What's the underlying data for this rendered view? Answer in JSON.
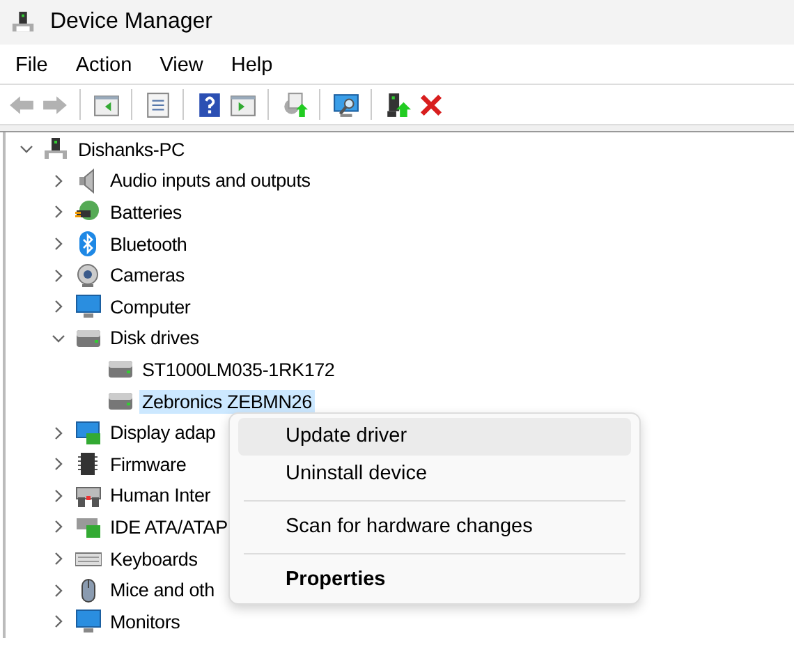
{
  "window": {
    "title": "Device Manager"
  },
  "menu_bar": [
    "File",
    "Action",
    "View",
    "Help"
  ],
  "toolbar": [
    {
      "kind": "back",
      "disabled": true
    },
    {
      "kind": "forward",
      "disabled": true
    },
    {
      "kind": "sep"
    },
    {
      "kind": "tree-pane"
    },
    {
      "kind": "sep"
    },
    {
      "kind": "sheet"
    },
    {
      "kind": "sep"
    },
    {
      "kind": "help"
    },
    {
      "kind": "action-pane"
    },
    {
      "kind": "sep"
    },
    {
      "kind": "update"
    },
    {
      "kind": "sep"
    },
    {
      "kind": "scan"
    },
    {
      "kind": "sep"
    },
    {
      "kind": "enable"
    },
    {
      "kind": "remove"
    }
  ],
  "tree": {
    "label": "Dishanks-PC",
    "kind": "pc",
    "expanded": true,
    "children": [
      {
        "label": "Audio inputs and outputs",
        "kind": "speaker",
        "expanded": false
      },
      {
        "label": "Batteries",
        "kind": "battery",
        "expanded": false
      },
      {
        "label": "Bluetooth",
        "kind": "bluetooth",
        "expanded": false
      },
      {
        "label": "Cameras",
        "kind": "camera",
        "expanded": false
      },
      {
        "label": "Computer",
        "kind": "monitor",
        "expanded": false
      },
      {
        "label": "Disk drives",
        "kind": "drive",
        "expanded": true,
        "children": [
          {
            "label": "ST1000LM035-1RK172",
            "kind": "drive",
            "selected": false
          },
          {
            "label": "Zebronics ZEBMN26",
            "kind": "drive",
            "selected": true
          }
        ]
      },
      {
        "label": "Display adap",
        "kind": "display",
        "expanded": false
      },
      {
        "label": "Firmware",
        "kind": "chip",
        "expanded": false
      },
      {
        "label": "Human Inter",
        "kind": "hid",
        "expanded": false
      },
      {
        "label": "IDE ATA/ATAP",
        "kind": "ide",
        "expanded": false
      },
      {
        "label": "Keyboards",
        "kind": "keyboard",
        "expanded": false
      },
      {
        "label": "Mice and oth",
        "kind": "mouse",
        "expanded": false
      },
      {
        "label": "Monitors",
        "kind": "monitor",
        "expanded": false
      }
    ]
  },
  "context_menu": [
    {
      "kind": "item",
      "label": "Update driver",
      "selected": true,
      "default": false
    },
    {
      "kind": "item",
      "label": "Uninstall device",
      "selected": false,
      "default": false
    },
    {
      "kind": "separator"
    },
    {
      "kind": "item",
      "label": "Scan for hardware changes",
      "selected": false,
      "default": false
    },
    {
      "kind": "separator"
    },
    {
      "kind": "item",
      "label": "Properties",
      "selected": false,
      "default": true
    }
  ]
}
